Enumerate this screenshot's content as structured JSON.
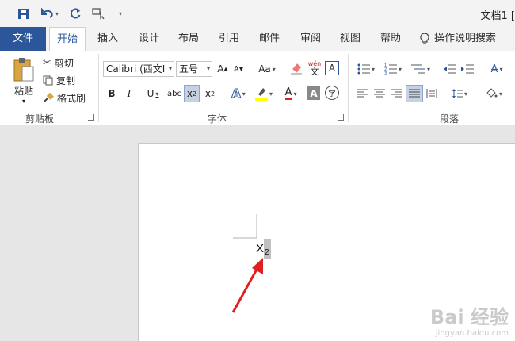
{
  "title": "文档1 [",
  "tabs": [
    "文件",
    "开始",
    "插入",
    "设计",
    "布局",
    "引用",
    "邮件",
    "审阅",
    "视图",
    "帮助",
    "操作说明搜索"
  ],
  "clipboard": {
    "paste": "粘贴",
    "cut": "剪切",
    "copy": "复制",
    "format_painter": "格式刷",
    "group": "剪贴板"
  },
  "font": {
    "name": "Calibri (西文I",
    "size": "五号",
    "group": "字体",
    "ruby_top": "wén",
    "ruby_char": "文",
    "border_char": "A",
    "enclose_char": "字"
  },
  "paragraph": {
    "group": "段落"
  },
  "document": {
    "text": "X",
    "subscript": "2"
  },
  "watermark": {
    "brand": "Bai 经验",
    "url": "jingyan.baidu.com"
  },
  "colors": {
    "accent": "#2b579a",
    "arrow": "#e02020",
    "highlight": "#ffff00",
    "font_color": "#e02020"
  }
}
